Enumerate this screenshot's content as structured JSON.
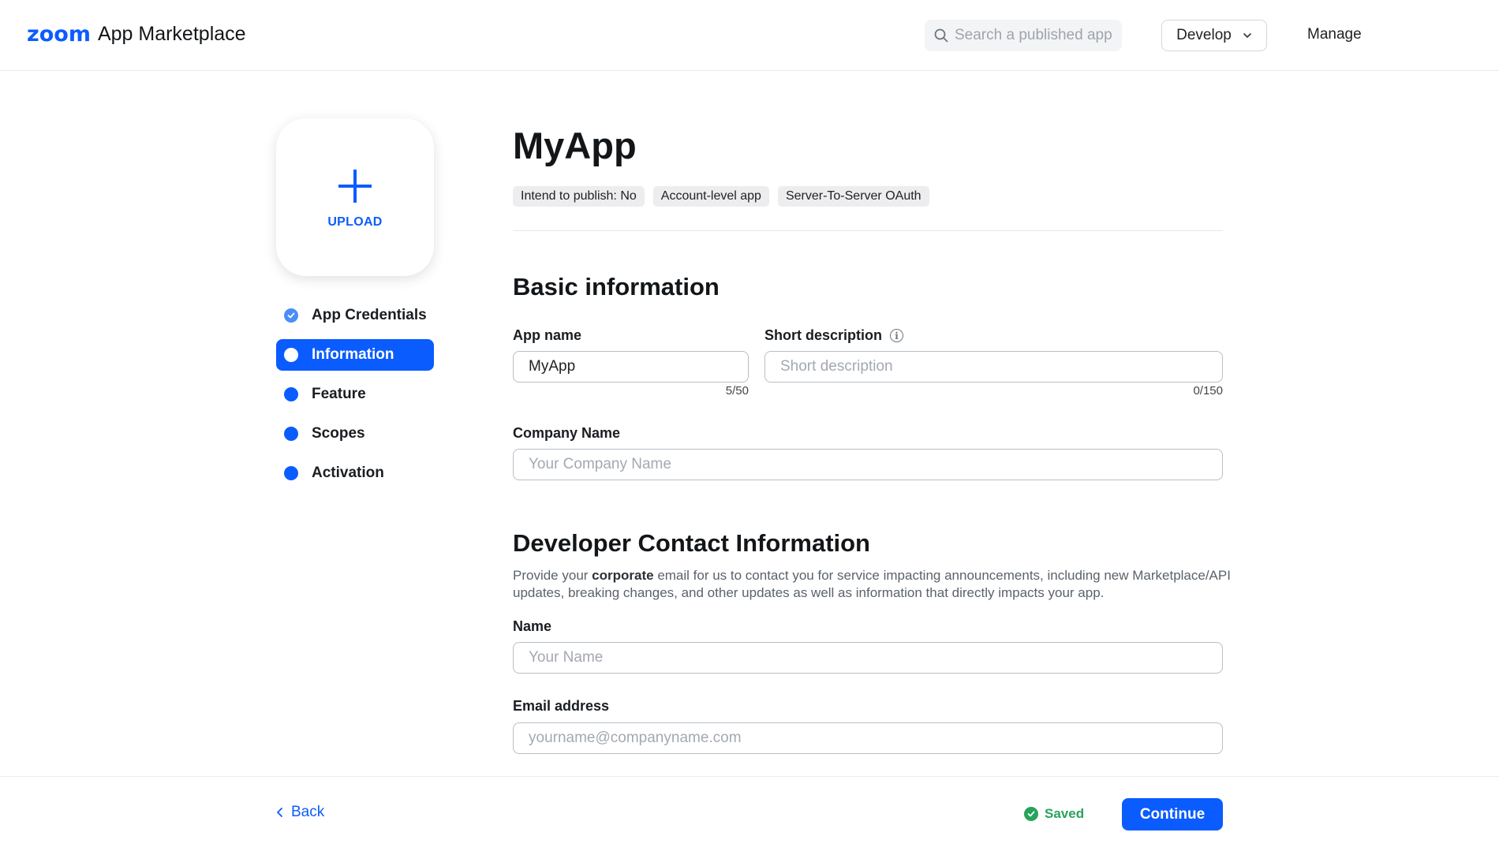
{
  "header": {
    "logo_brand": "zoom",
    "logo_text": "App Marketplace",
    "search_placeholder": "Search a published app",
    "develop_label": "Develop",
    "manage_label": "Manage"
  },
  "sidebar": {
    "upload_label": "UPLOAD",
    "items": [
      {
        "label": "App Credentials",
        "state": "done"
      },
      {
        "label": "Information",
        "state": "active"
      },
      {
        "label": "Feature",
        "state": "pending"
      },
      {
        "label": "Scopes",
        "state": "pending"
      },
      {
        "label": "Activation",
        "state": "pending"
      }
    ]
  },
  "main": {
    "app_title": "MyApp",
    "tags": [
      "Intend to publish: No",
      "Account-level app",
      "Server-To-Server OAuth"
    ],
    "basic_info": {
      "title": "Basic information",
      "app_name_label": "App name",
      "app_name_value": "MyApp",
      "app_name_counter": "5/50",
      "short_desc_label": "Short description",
      "short_desc_placeholder": "Short description",
      "short_desc_counter": "0/150",
      "company_label": "Company Name",
      "company_placeholder": "Your Company Name"
    },
    "developer_contact": {
      "title": "Developer Contact Information",
      "desc_prefix": "Provide your ",
      "desc_bold": "corporate",
      "desc_suffix": " email for us to contact you for service impacting announcements, including new Marketplace/API updates, breaking changes, and other updates as well as information that directly impacts your app.",
      "name_label": "Name",
      "name_placeholder": "Your Name",
      "email_label": "Email address",
      "email_placeholder": "yourname@companyname.com"
    }
  },
  "footer": {
    "back_label": "Back",
    "saved_label": "Saved",
    "continue_label": "Continue"
  },
  "colors": {
    "accent": "#0b5cff",
    "success": "#27a35b"
  }
}
